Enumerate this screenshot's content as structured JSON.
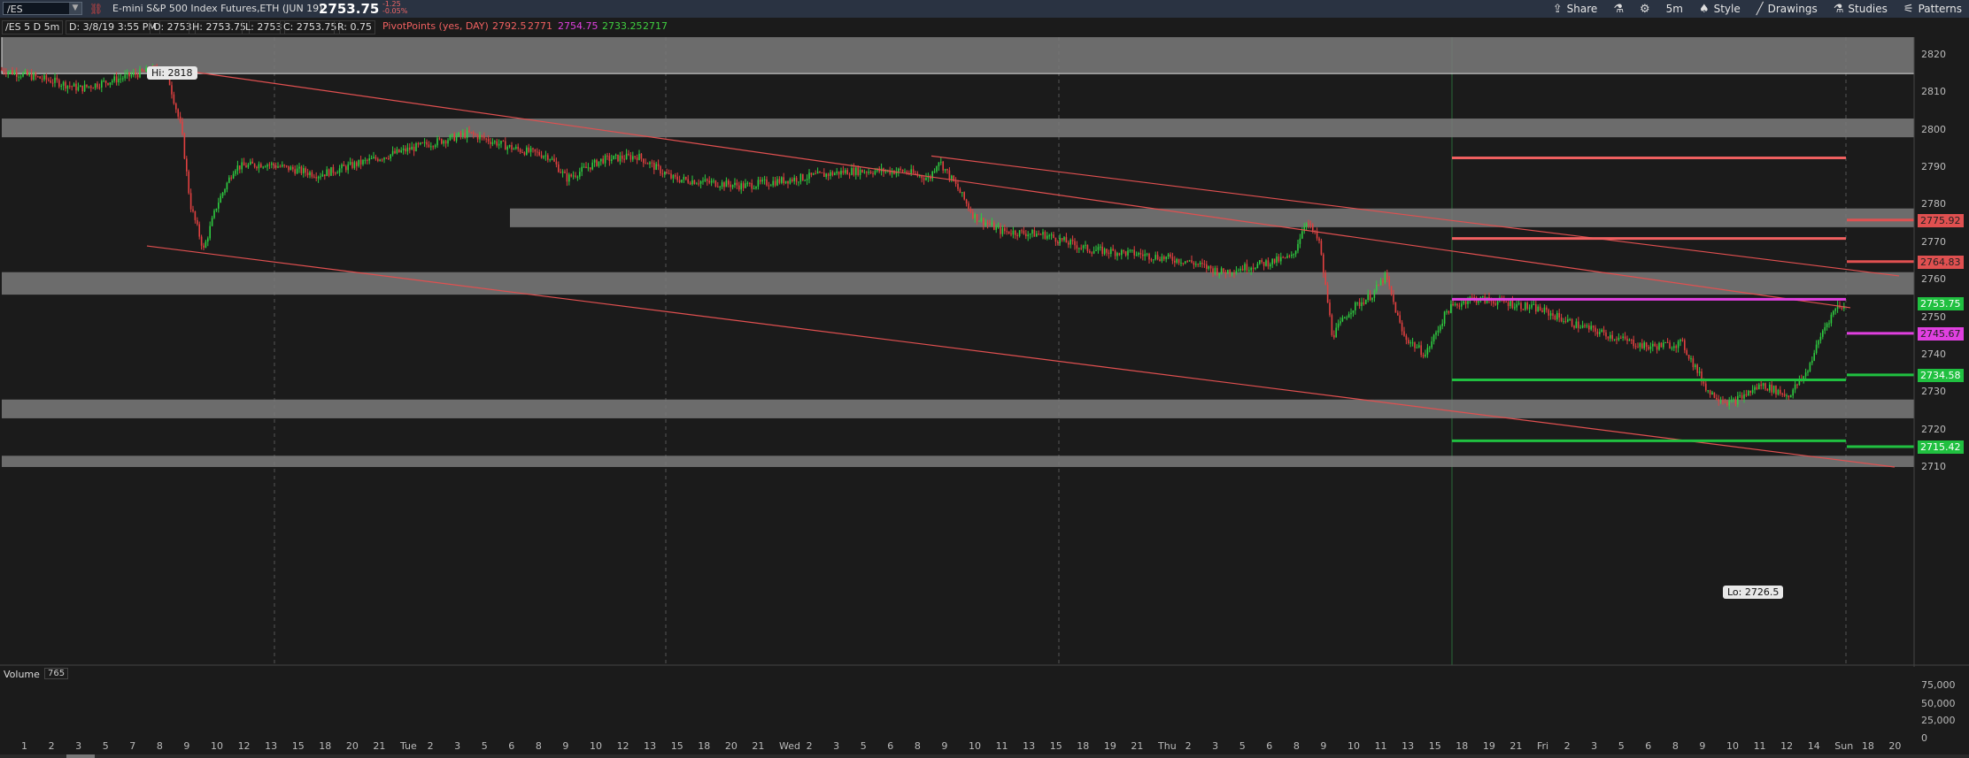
{
  "header": {
    "symbol": "/ES",
    "description": "E-mini S&P 500 Index Futures,ETH (JUN 19)",
    "last": "2753.75",
    "change": "-1.25",
    "change_pct": "-0.05%",
    "toolbar": {
      "share": "Share",
      "timeframe": "5m",
      "style": "Style",
      "drawings": "Drawings",
      "studies": "Studies",
      "patterns": "Patterns"
    }
  },
  "infobar": {
    "title": "/ES 5 D 5m",
    "date": "D: 3/8/19 3:55 PM",
    "open": "O: 2753",
    "high": "H: 2753.75",
    "low": "L: 2753",
    "close": "C: 2753.75",
    "range": "R: 0.75",
    "pivot_label": "PivotPoints (yes, DAY)",
    "pivots": [
      "2792.5",
      "2771",
      "2754.75",
      "2733.25",
      "2717"
    ],
    "pivot_colors": [
      "#f06060",
      "#f06060",
      "#e040e0",
      "#40d040",
      "#40d040"
    ]
  },
  "chart": {
    "price_axis": [
      "2820",
      "2810",
      "2800",
      "2790",
      "2780",
      "2770",
      "2760",
      "2750",
      "2740",
      "2730",
      "2720",
      "2710"
    ],
    "hi_callout": "Hi: 2818",
    "lo_callout": "Lo: 2726.5",
    "price_tags": [
      {
        "value": "2775.92",
        "color": "#e05050"
      },
      {
        "value": "2764.83",
        "color": "#e05050"
      },
      {
        "value": "2753.75",
        "color": "#20c040"
      },
      {
        "value": "2745.67",
        "color": "#e040e0"
      },
      {
        "value": "2734.58",
        "color": "#20c040"
      },
      {
        "value": "2715.42",
        "color": "#20c040"
      }
    ],
    "session_marker": "3/8/19",
    "colors": {
      "up": "#2ecc40",
      "down": "#e04040",
      "zone": "#7a7a7a",
      "trend": "#e05050",
      "volume": "#3a9bd5"
    }
  },
  "volume": {
    "label": "Volume",
    "count": "765",
    "axis": [
      "75,000",
      "50,000",
      "25,000",
      "0"
    ]
  },
  "time_axis": [
    "1",
    "2",
    "3",
    "5",
    "7",
    "8",
    "9",
    "10",
    "12",
    "13",
    "15",
    "18",
    "20",
    "21",
    "Tue",
    "2",
    "3",
    "5",
    "6",
    "8",
    "9",
    "10",
    "12",
    "13",
    "15",
    "18",
    "20",
    "21",
    "Wed",
    "2",
    "3",
    "5",
    "6",
    "8",
    "9",
    "10",
    "11",
    "13",
    "15",
    "18",
    "19",
    "21",
    "Thu",
    "2",
    "3",
    "5",
    "6",
    "8",
    "9",
    "10",
    "11",
    "13",
    "15",
    "18",
    "19",
    "21",
    "Fri",
    "2",
    "3",
    "5",
    "6",
    "8",
    "9",
    "10",
    "11",
    "12",
    "14",
    "Sun",
    "18",
    "20"
  ]
}
